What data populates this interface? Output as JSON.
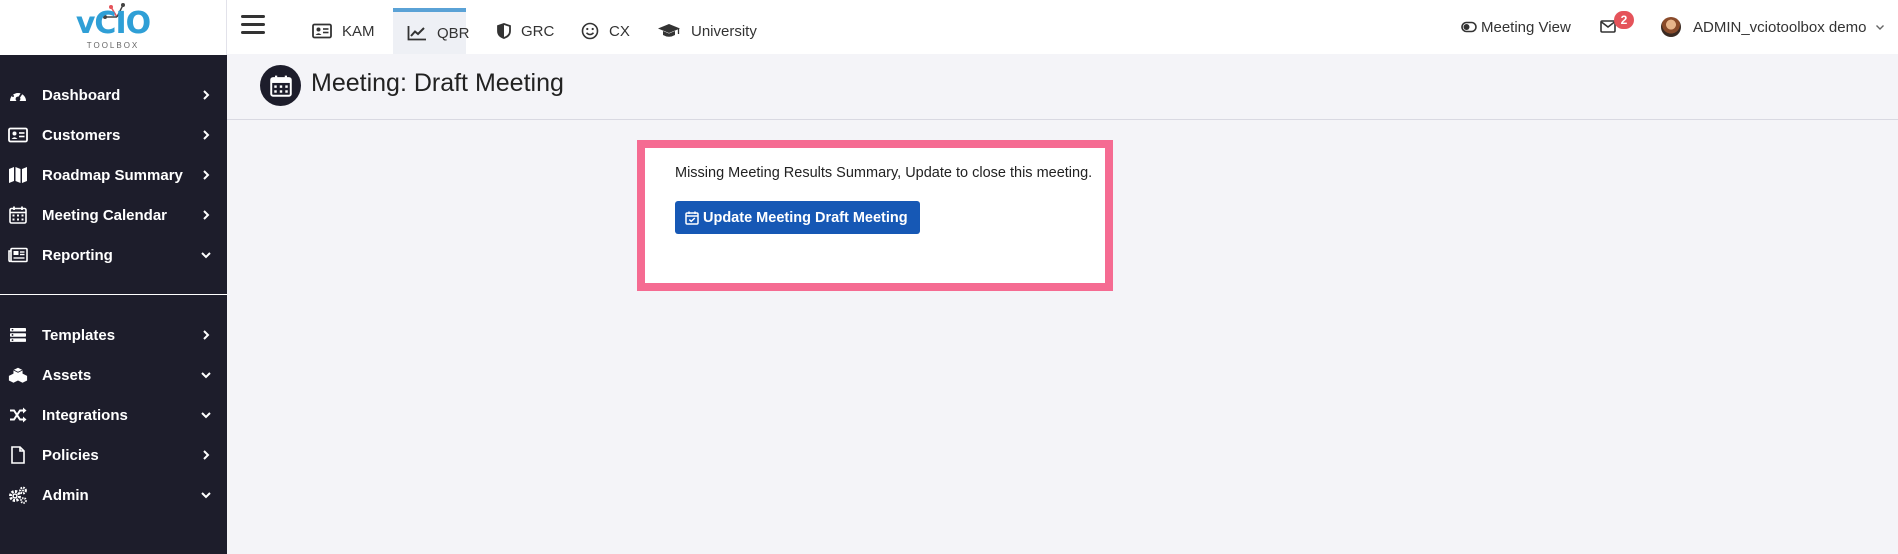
{
  "brand": {
    "logo_text": "vCIO",
    "logo_sub": "TOOLBOX"
  },
  "sidebar": {
    "items": [
      {
        "label": "Dashboard",
        "icon": "dashboard-icon",
        "chevron": "right"
      },
      {
        "label": "Customers",
        "icon": "address-card-icon",
        "chevron": "right"
      },
      {
        "label": "Roadmap Summary",
        "icon": "map-icon",
        "chevron": "right"
      },
      {
        "label": "Meeting Calendar",
        "icon": "calendar-icon",
        "chevron": "right"
      },
      {
        "label": "Reporting",
        "icon": "newspaper-icon",
        "chevron": "down"
      }
    ],
    "items2": [
      {
        "label": "Templates",
        "icon": "templates-icon",
        "chevron": "right"
      },
      {
        "label": "Assets",
        "icon": "cubes-icon",
        "chevron": "down"
      },
      {
        "label": "Integrations",
        "icon": "shuffle-icon",
        "chevron": "down"
      },
      {
        "label": "Policies",
        "icon": "file-icon",
        "chevron": "right"
      },
      {
        "label": "Admin",
        "icon": "gears-icon",
        "chevron": "down"
      }
    ]
  },
  "topnav": {
    "tabs": [
      {
        "label": "KAM",
        "icon": "id-card-icon"
      },
      {
        "label": "QBR",
        "icon": "line-chart-icon",
        "active": true
      },
      {
        "label": "GRC",
        "icon": "shield-icon"
      },
      {
        "label": "CX",
        "icon": "smile-icon"
      },
      {
        "label": "University",
        "icon": "graduation-cap-icon"
      }
    ],
    "meeting_view": "Meeting View",
    "mail_count": "2",
    "user_name": "ADMIN_vciotoolbox demo"
  },
  "page": {
    "title": "Meeting: Draft Meeting"
  },
  "alert": {
    "message": "Missing Meeting Results Summary, Update to close this meeting.",
    "button_label": "Update Meeting Draft Meeting"
  },
  "colors": {
    "sidebar_bg": "#1d1d2b",
    "accent_blue": "#1658b5",
    "highlight_pink": "#f56b92",
    "badge_red": "#e5535a",
    "active_tab_border": "#5aa2d6"
  }
}
